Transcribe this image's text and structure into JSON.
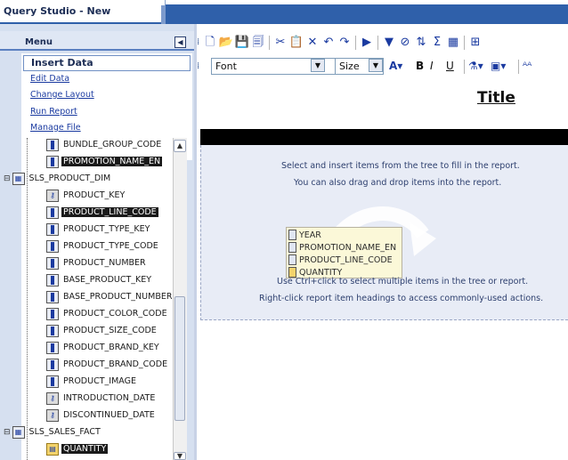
{
  "app": {
    "title": "Query Studio  - New"
  },
  "menu": {
    "label": "Menu",
    "collapse_glyph": "◀",
    "active_item": "Insert Data",
    "links": [
      "Edit Data",
      "Change Layout",
      "Run Report",
      "Manage File"
    ]
  },
  "tree": {
    "items": [
      {
        "label": "BUNDLE_GROUP_CODE",
        "icon": "column-icon",
        "selected": false
      },
      {
        "label": "PROMOTION_NAME_EN",
        "icon": "column-icon",
        "selected": true
      },
      {
        "label": "SLS_PRODUCT_DIM",
        "icon": "table-icon",
        "selected": false,
        "folder": true
      },
      {
        "label": "PRODUCT_KEY",
        "icon": "key-icon",
        "selected": false
      },
      {
        "label": "PRODUCT_LINE_CODE",
        "icon": "column-icon",
        "selected": true
      },
      {
        "label": "PRODUCT_TYPE_KEY",
        "icon": "column-icon",
        "selected": false
      },
      {
        "label": "PRODUCT_TYPE_CODE",
        "icon": "column-icon",
        "selected": false
      },
      {
        "label": "PRODUCT_NUMBER",
        "icon": "column-icon",
        "selected": false
      },
      {
        "label": "BASE_PRODUCT_KEY",
        "icon": "column-icon",
        "selected": false
      },
      {
        "label": "BASE_PRODUCT_NUMBER",
        "icon": "column-icon",
        "selected": false
      },
      {
        "label": "PRODUCT_COLOR_CODE",
        "icon": "column-icon",
        "selected": false
      },
      {
        "label": "PRODUCT_SIZE_CODE",
        "icon": "column-icon",
        "selected": false
      },
      {
        "label": "PRODUCT_BRAND_KEY",
        "icon": "column-icon",
        "selected": false
      },
      {
        "label": "PRODUCT_BRAND_CODE",
        "icon": "column-icon",
        "selected": false
      },
      {
        "label": "PRODUCT_IMAGE",
        "icon": "column-icon",
        "selected": false
      },
      {
        "label": "INTRODUCTION_DATE",
        "icon": "key-icon",
        "selected": false
      },
      {
        "label": "DISCONTINUED_DATE",
        "icon": "key-icon",
        "selected": false
      },
      {
        "label": "SLS_SALES_FACT",
        "icon": "table-icon",
        "selected": false,
        "folder": true
      },
      {
        "label": "QUANTITY",
        "icon": "measure-icon",
        "selected": true
      }
    ]
  },
  "toolbar2": {
    "font_value": "Font",
    "size_value": "Size",
    "bold": "B",
    "italic": "I",
    "underline": "U"
  },
  "report": {
    "title": "Title",
    "instructions": [
      "Select and insert items from the tree to fill in the report.",
      "You can also drag and drop items into the report.",
      "Use Ctrl+click to select multiple items in the tree or report.",
      "Right-click report item headings to access commonly-used actions."
    ],
    "drag_preview_items": [
      "YEAR",
      "PROMOTION_NAME_EN",
      "PRODUCT_LINE_CODE",
      "QUANTITY"
    ]
  }
}
